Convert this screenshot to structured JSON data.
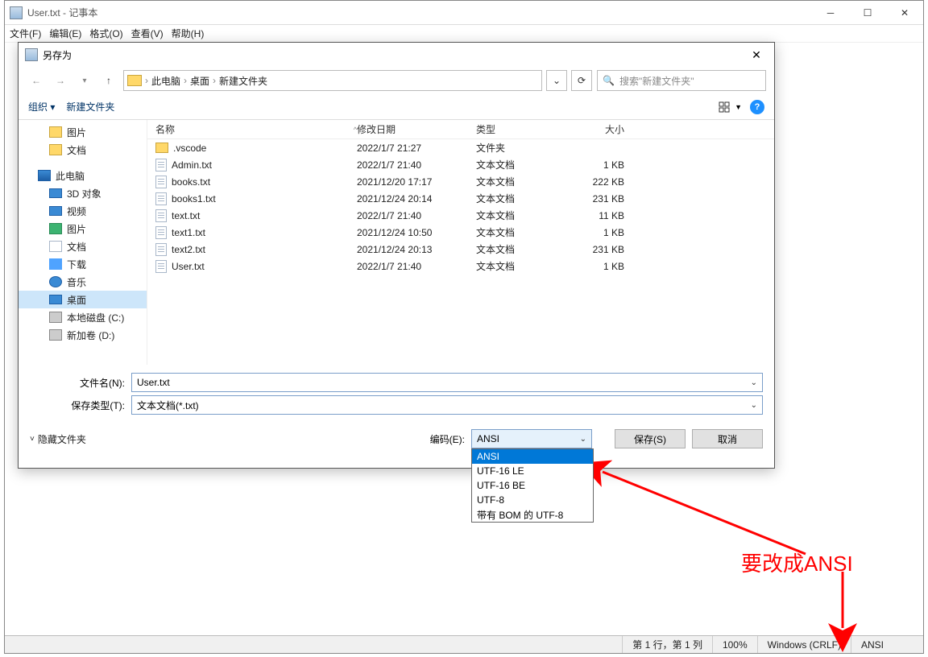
{
  "window": {
    "title": "User.txt - 记事本",
    "menus": [
      "文件(F)",
      "编辑(E)",
      "格式(O)",
      "查看(V)",
      "帮助(H)"
    ]
  },
  "statusbar": {
    "position": "第 1 行，第 1 列",
    "zoom": "100%",
    "line_ending": "Windows (CRLF)",
    "encoding": "ANSI"
  },
  "dialog": {
    "title": "另存为",
    "breadcrumbs": [
      "此电脑",
      "桌面",
      "新建文件夹"
    ],
    "search_placeholder": "搜索\"新建文件夹\"",
    "organize": "组织",
    "new_folder": "新建文件夹",
    "tree": {
      "pictures": "图片",
      "documents": "文档",
      "this_pc": "此电脑",
      "threed": "3D 对象",
      "videos": "视频",
      "pics2": "图片",
      "docs2": "文档",
      "downloads": "下载",
      "music": "音乐",
      "desktop": "桌面",
      "disk_c": "本地磁盘 (C:)",
      "disk_d": "新加卷 (D:)"
    },
    "columns": {
      "name": "名称",
      "date": "修改日期",
      "type": "类型",
      "size": "大小"
    },
    "files": [
      {
        "name": ".vscode",
        "date": "2022/1/7 21:27",
        "type": "文件夹",
        "size": "",
        "kind": "folder"
      },
      {
        "name": "Admin.txt",
        "date": "2022/1/7 21:40",
        "type": "文本文档",
        "size": "1 KB",
        "kind": "txt"
      },
      {
        "name": "books.txt",
        "date": "2021/12/20 17:17",
        "type": "文本文档",
        "size": "222 KB",
        "kind": "txt"
      },
      {
        "name": "books1.txt",
        "date": "2021/12/24 20:14",
        "type": "文本文档",
        "size": "231 KB",
        "kind": "txt"
      },
      {
        "name": "text.txt",
        "date": "2022/1/7 21:40",
        "type": "文本文档",
        "size": "11 KB",
        "kind": "txt"
      },
      {
        "name": "text1.txt",
        "date": "2021/12/24 10:50",
        "type": "文本文档",
        "size": "1 KB",
        "kind": "txt"
      },
      {
        "name": "text2.txt",
        "date": "2021/12/24 20:13",
        "type": "文本文档",
        "size": "231 KB",
        "kind": "txt"
      },
      {
        "name": "User.txt",
        "date": "2022/1/7 21:40",
        "type": "文本文档",
        "size": "1 KB",
        "kind": "txt"
      }
    ],
    "filename_label": "文件名(N):",
    "filename_value": "User.txt",
    "filetype_label": "保存类型(T):",
    "filetype_value": "文本文档(*.txt)",
    "hide_folders": "隐藏文件夹",
    "encoding_label": "编码(E):",
    "encoding_selected": "ANSI",
    "encoding_options": [
      "ANSI",
      "UTF-16 LE",
      "UTF-16 BE",
      "UTF-8",
      "带有 BOM 的 UTF-8"
    ],
    "save_btn": "保存(S)",
    "cancel_btn": "取消"
  },
  "annotation": {
    "text": "要改成ANSI"
  }
}
